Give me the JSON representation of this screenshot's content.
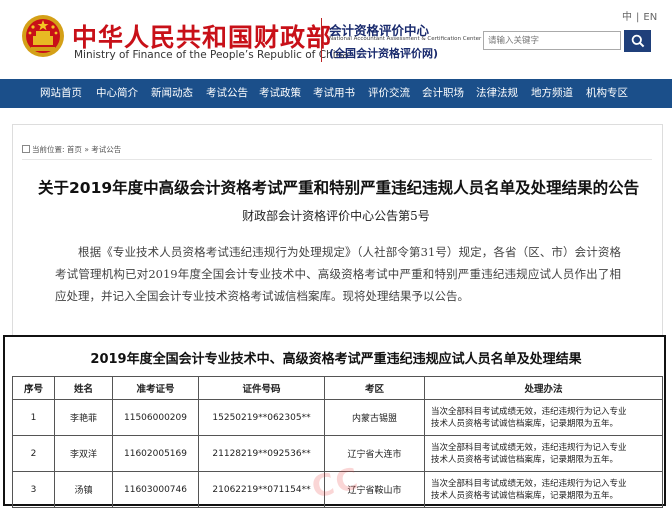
{
  "header": {
    "ministry_cn": "中华人民共和国财政部",
    "ministry_en": "Ministry of Finance of the People’s Republic of China",
    "center_cn": "会计资格评价中心",
    "center_en": "National Accountant Assessment & Certification Center",
    "center_sub": "(全国会计资格评价网)",
    "lang_cn": "中",
    "lang_sep": "|",
    "lang_en": "EN",
    "search_placeholder": "请输入关键字",
    "search_icon": "search-icon",
    "emblem_icon": "national-emblem-icon"
  },
  "nav": {
    "items": [
      "网站首页",
      "中心简介",
      "新闻动态",
      "考试公告",
      "考试政策",
      "考试用书",
      "评价交流",
      "会计职场",
      "法律法规",
      "地方频道",
      "机构专区"
    ]
  },
  "breadcrumb": {
    "prefix": "当前位置:",
    "home": "首页",
    "sep": "»",
    "current": "考试公告"
  },
  "article": {
    "title": "关于2019年度中高级会计资格考试严重和特别严重违纪违规人员名单及处理结果的公告",
    "subtitle": "财政部会计资格评价中心公告第5号",
    "paragraph": "根据《专业技术人员资格考试违纪违规行为处理规定》（人社部令第31号）规定，各省（区、市）会计资格考试管理机构已对2019年度全国会计专业技术中、高级资格考试中严重和特别严重违纪违规应试人员作出了相应处理，并记入全国会计专业技术资格考试诚信档案库。现将处理结果予以公告。"
  },
  "results_table": {
    "title": "2019年度全国会计专业技术中、高级资格考试严重违纪违规应试人员名单及处理结果",
    "headers": [
      "序号",
      "姓名",
      "准考证号",
      "证件号码",
      "考区",
      "处理办法"
    ],
    "rows": [
      {
        "no": "1",
        "name": "李艳菲",
        "ticket": "11506000209",
        "id": "15250219**062305**",
        "area": "内蒙古锡盟",
        "action": [
          "当次全部科目考试成绩无效，违纪违规行为记入专业",
          "技术人员资格考试诚信档案库，记录期限为五年。"
        ]
      },
      {
        "no": "2",
        "name": "李双洋",
        "ticket": "11602005169",
        "id": "21128219**092536**",
        "area": "辽宁省大连市",
        "action": [
          "当次全部科目考试成绩无效，违纪违规行为记入专业",
          "技术人员资格考试诚信档案库，记录期限为五年。"
        ]
      },
      {
        "no": "3",
        "name": "汤镇",
        "ticket": "11603000746",
        "id": "21062219**071154**",
        "area": "辽宁省鞍山市",
        "action": [
          "当次全部科目考试成绩无效，违纪违规行为记入专业",
          "技术人员资格考试诚信档案库，记录期限为五年。"
        ]
      }
    ]
  },
  "watermark": "CC",
  "colors": {
    "brand_red": "#c81018",
    "nav_blue": "#1b4f8a",
    "center_blue": "#1a2b6e"
  }
}
